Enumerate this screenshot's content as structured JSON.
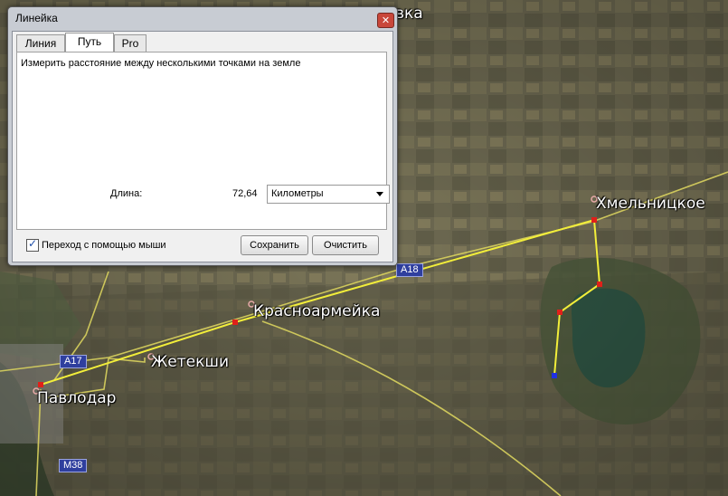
{
  "dialog": {
    "title": "Линейка",
    "close_glyph": "✕",
    "tabs": [
      "Линия",
      "Путь",
      "Pro"
    ],
    "active_tab": "Путь",
    "description": "Измерить расстояние между несколькими точками на земле",
    "length_label": "Длина:",
    "length_value": "72,64",
    "unit_selected": "Километры",
    "checkbox_label": "Переход с помощью мыши",
    "checkbox_checked": true,
    "save_button": "Сохранить",
    "clear_button": "Очистить"
  },
  "map": {
    "places": {
      "pavlodar": "Павлодар",
      "zhetekshi": "Жетекши",
      "krasnoarmeyka": "Красноармейка",
      "khmelnitskoe": "Хмельницкое",
      "top_partial": "вка"
    },
    "roads": {
      "a17": "A17",
      "a18": "A18",
      "m38": "M38"
    },
    "path_color": "#f2ee3a",
    "marker_color": "#e0201a",
    "end_marker_color": "#2030e0"
  }
}
